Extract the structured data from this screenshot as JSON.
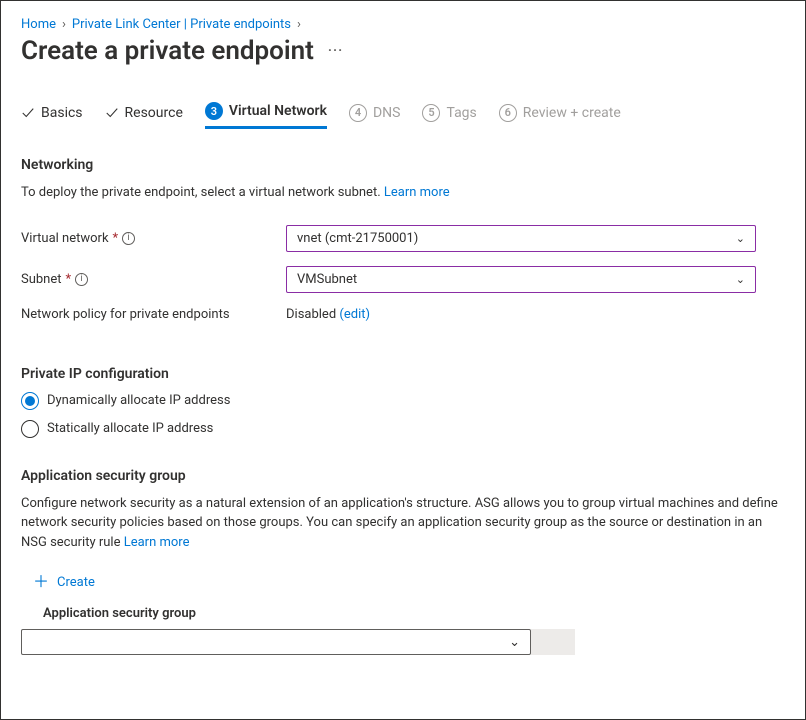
{
  "breadcrumb": {
    "home": "Home",
    "middle": "Private Link Center | Private endpoints"
  },
  "page_title": "Create a private endpoint",
  "tabs": {
    "basics": "Basics",
    "resource": "Resource",
    "vnet_num": "3",
    "vnet": "Virtual Network",
    "dns_num": "4",
    "dns": "DNS",
    "tags_num": "5",
    "tags": "Tags",
    "review_num": "6",
    "review": "Review + create"
  },
  "networking": {
    "title": "Networking",
    "desc": "To deploy the private endpoint, select a virtual network subnet.  ",
    "learn_more": "Learn more",
    "vnet_label": "Virtual network",
    "vnet_value": "vnet (cmt-21750001)",
    "subnet_label": "Subnet",
    "subnet_value": "VMSubnet",
    "policy_label": "Network policy for private endpoints",
    "policy_value": "Disabled",
    "policy_edit": "(edit)"
  },
  "private_ip": {
    "title": "Private IP configuration",
    "dynamic": "Dynamically allocate IP address",
    "static": "Statically allocate IP address"
  },
  "asg": {
    "title": "Application security group",
    "desc": "Configure network security as a natural extension of an application's structure. ASG allows you to group virtual machines and define network security policies based on those groups. You can specify an application security group as the source or destination in an NSG security rule  ",
    "learn_more": "Learn more",
    "create": "Create",
    "field_label": "Application security group"
  }
}
